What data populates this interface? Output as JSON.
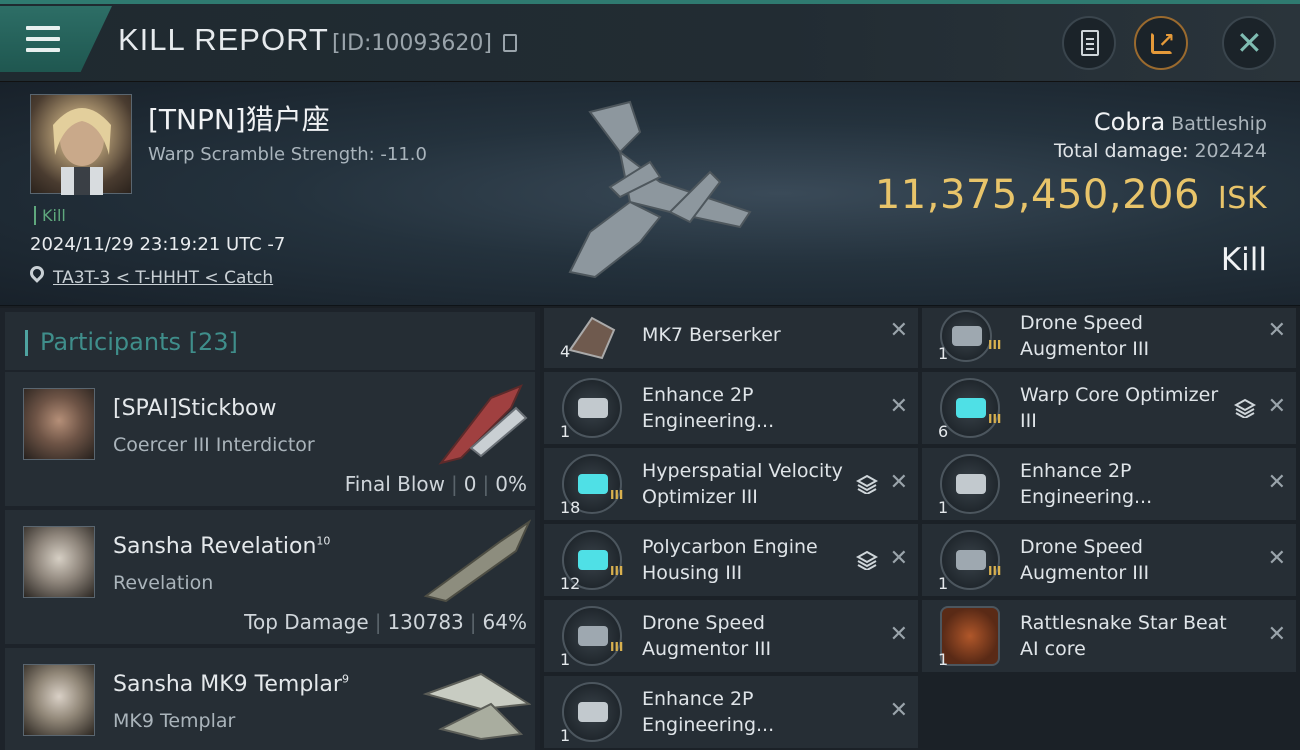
{
  "header": {
    "title": "KILL REPORT",
    "report_id": "[ID:10093620]",
    "icons": [
      "menu-icon",
      "copy-icon",
      "clipboard-icon",
      "share-icon",
      "close-icon"
    ]
  },
  "victim": {
    "name": "[TNPN]猎户座",
    "warp_scramble": "Warp Scramble Strength: -11.0",
    "tag": "Kill",
    "datetime": "2024/11/29 23:19:21 UTC -7",
    "location": "TA3T-3 < T-HHHT < Catch",
    "ship_name": "Cobra",
    "ship_class": "Battleship",
    "total_damage_label": "Total damage:",
    "total_damage_value": "202424",
    "isk_value": "11,375,450,206",
    "isk_unit": "ISK",
    "result": "Kill"
  },
  "participants": {
    "title": "Participants",
    "count": "[23]",
    "list": [
      {
        "name": "[SPAI]Stickbow",
        "sup": "",
        "ship": "Coercer III Interdictor",
        "stat_label": "Final Blow",
        "stat_value": "0",
        "stat_pct": "0%"
      },
      {
        "name": "Sansha Revelation",
        "sup": "10",
        "ship": "Revelation",
        "stat_label": "Top Damage",
        "stat_value": "130783",
        "stat_pct": "64%"
      },
      {
        "name": "Sansha MK9 Templar",
        "sup": "9",
        "ship": "MK9 Templar",
        "stat_label": "",
        "stat_value": "",
        "stat_pct": ""
      }
    ]
  },
  "items": {
    "left": [
      {
        "qty": "4",
        "name": "MK7  Berserker",
        "tier": "",
        "stack": false
      },
      {
        "qty": "1",
        "name": "Enhance 2P Engineering...",
        "tier": "",
        "stack": false
      },
      {
        "qty": "18",
        "name": "Hyperspatial Velocity Optimizer III",
        "tier": "III",
        "stack": true
      },
      {
        "qty": "12",
        "name": "Polycarbon Engine Housing III",
        "tier": "III",
        "stack": true
      },
      {
        "qty": "1",
        "name": "Drone Speed Augmentor III",
        "tier": "III",
        "stack": false
      },
      {
        "qty": "1",
        "name": "Enhance 2P Engineering...",
        "tier": "",
        "stack": false
      }
    ],
    "right": [
      {
        "qty": "1",
        "name": "Drone Speed Augmentor III",
        "tier": "III",
        "stack": false
      },
      {
        "qty": "6",
        "name": "Warp Core Optimizer III",
        "tier": "III",
        "stack": true
      },
      {
        "qty": "1",
        "name": "Enhance 2P Engineering...",
        "tier": "",
        "stack": false
      },
      {
        "qty": "1",
        "name": "Drone Speed Augmentor III",
        "tier": "III",
        "stack": false
      },
      {
        "qty": "1",
        "name": "Rattlesnake Star Beat AI core",
        "tier": "",
        "stack": false
      }
    ]
  },
  "colors": {
    "accent": "#2f7a70",
    "isk": "#e8c46a",
    "kill_tag": "#5fa87d",
    "participants_title": "#3f8e8b"
  }
}
